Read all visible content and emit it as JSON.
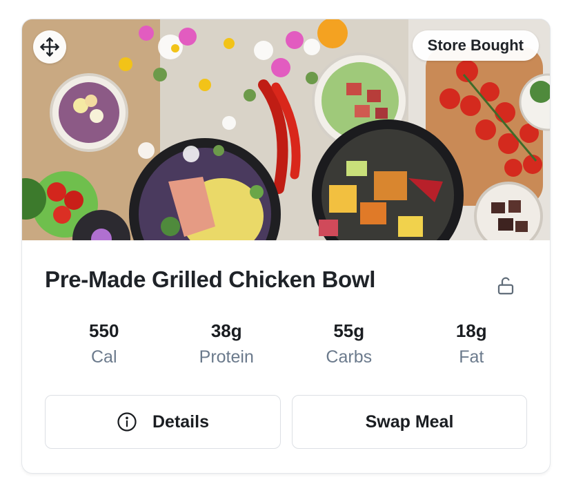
{
  "card": {
    "badge": "Store Bought",
    "title": "Pre-Made Grilled Chicken Bowl",
    "hero_image": "meal-spread-photo",
    "macros": [
      {
        "value": "550",
        "label": "Cal"
      },
      {
        "value": "38g",
        "label": "Protein"
      },
      {
        "value": "55g",
        "label": "Carbs"
      },
      {
        "value": "18g",
        "label": "Fat"
      }
    ],
    "buttons": {
      "details_label": "Details",
      "swap_label": "Swap Meal"
    },
    "icons": {
      "move": "move-arrows-icon",
      "lock": "unlock-icon",
      "info": "info-circle-icon"
    },
    "colors": {
      "title": "#1f2328",
      "label": "#6b7a8c",
      "border": "#dcdfe4"
    }
  }
}
